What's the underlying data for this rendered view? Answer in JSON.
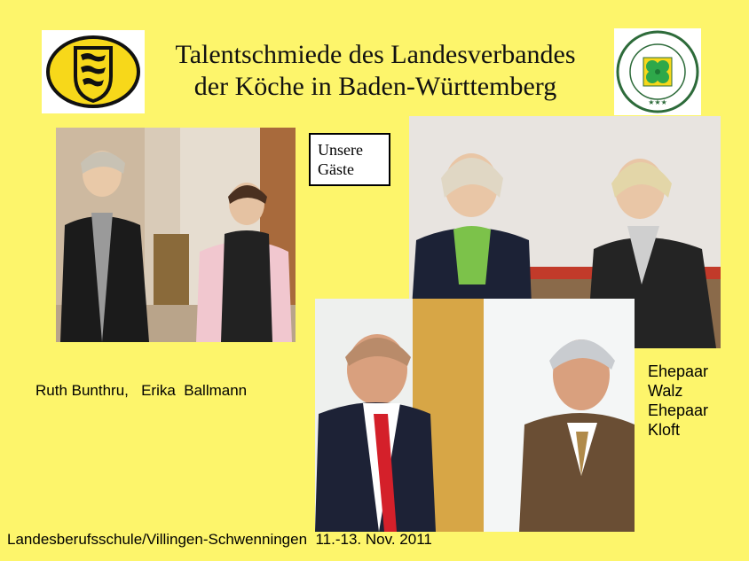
{
  "title": {
    "line1": "Talentschmiede des Landesverbandes",
    "line2": "der Köche in Baden-Württemberg"
  },
  "logos": {
    "left": "baden-wuerttemberg-coat-of-arms",
    "right": "verband-der-koeche-deutschlands-emblem"
  },
  "guests_box": {
    "line1": "Unsere",
    "line2": "Gäste"
  },
  "caption_left": "Ruth Bunthru,   Erika  Ballmann",
  "caption_right": {
    "line1": "Ehepaar",
    "line2": "Walz",
    "line3": "Ehepaar",
    "line4": "Kloft"
  },
  "footer": "Landesberufsschule/Villingen-Schwenningen  11.-13. Nov. 2011",
  "colors": {
    "background": "#fdf56b",
    "logo_yellow": "#f7d81a",
    "clover_green": "#2ea84a"
  }
}
